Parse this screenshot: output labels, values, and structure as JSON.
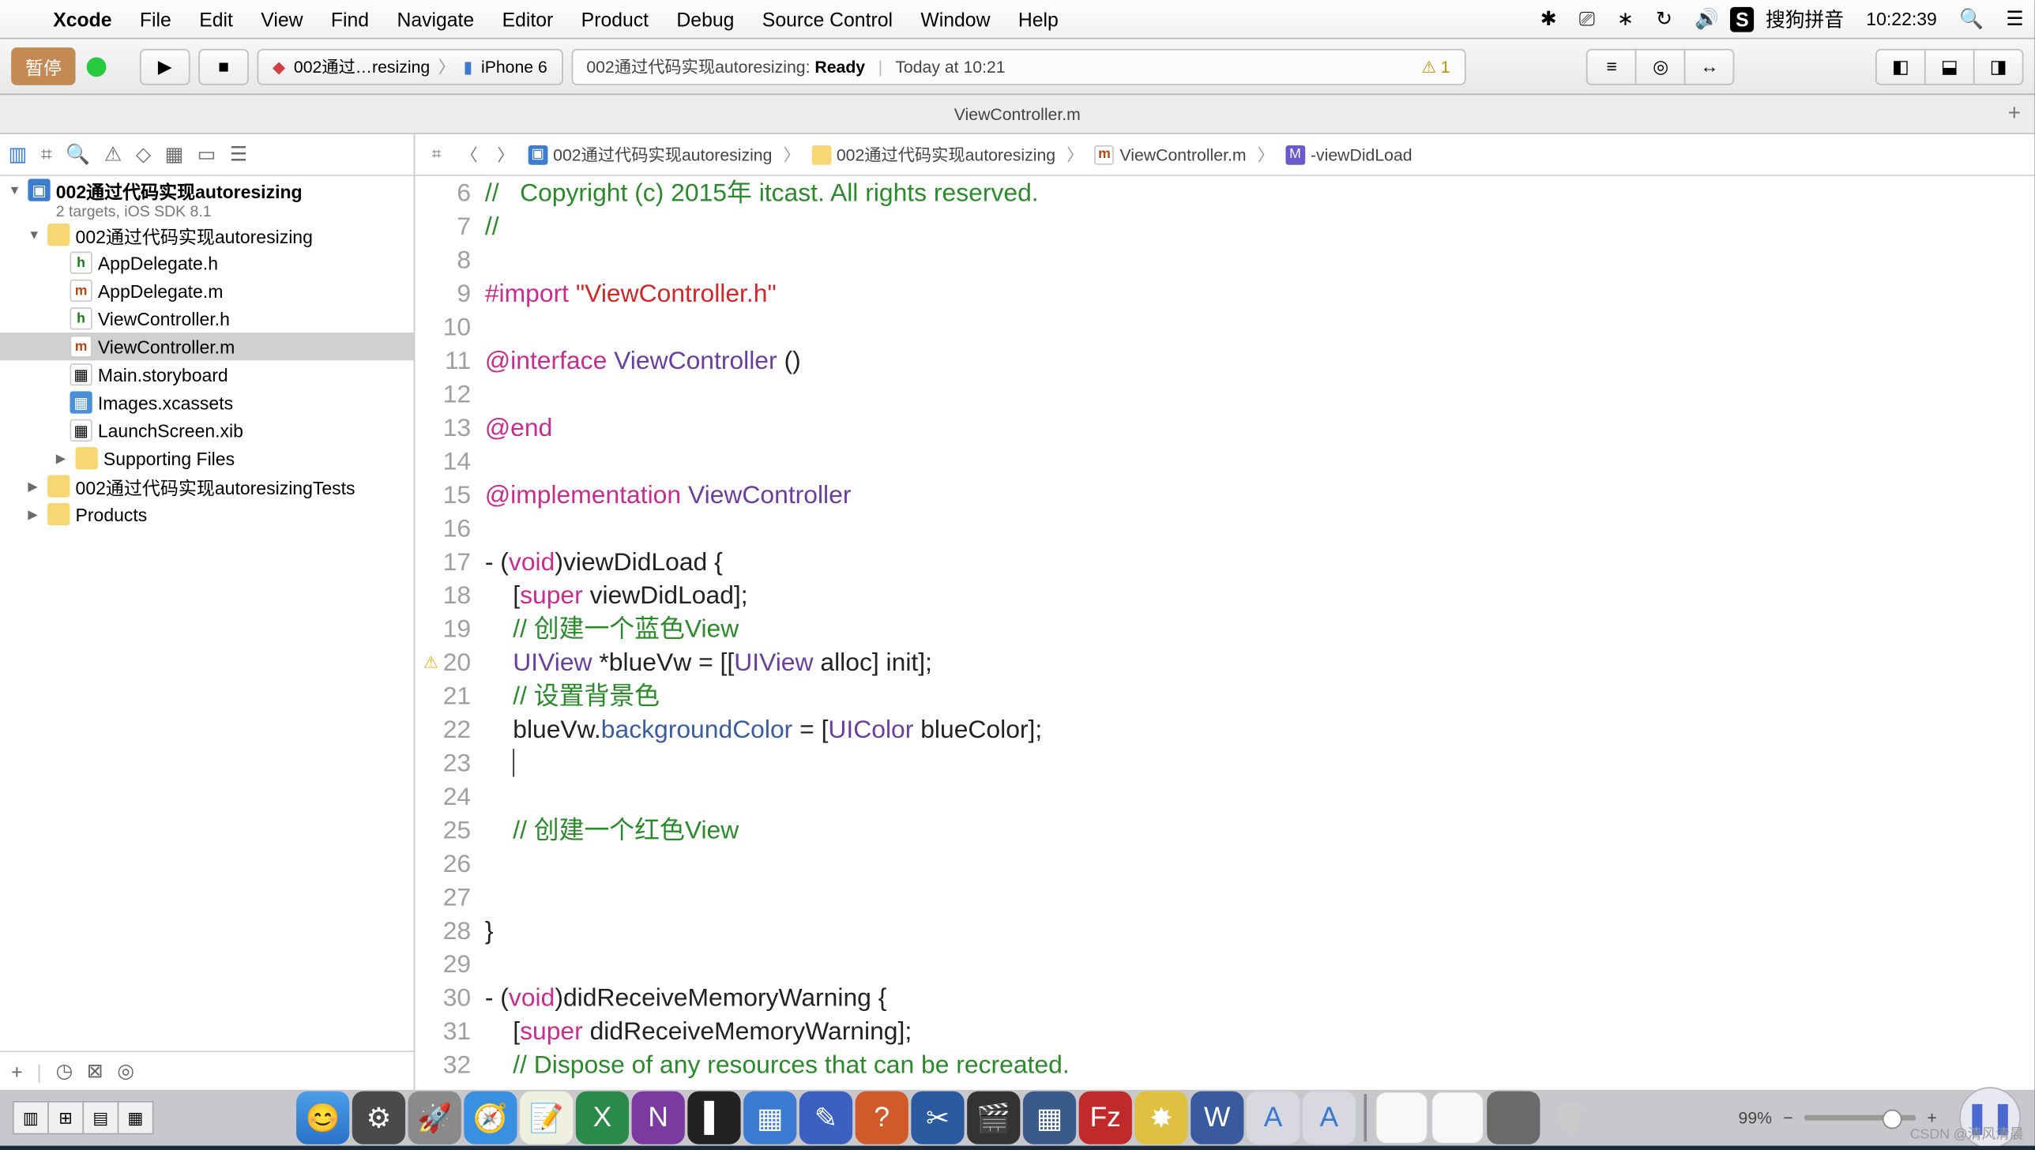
{
  "menubar": {
    "app": "Xcode",
    "items": [
      "File",
      "Edit",
      "View",
      "Find",
      "Navigate",
      "Editor",
      "Product",
      "Debug",
      "Source Control",
      "Window",
      "Help"
    ],
    "ime": "搜狗拼音",
    "clock": "10:22:39"
  },
  "toolbar": {
    "pause": "暂停",
    "scheme_project": "002通过…resizing",
    "scheme_device": "iPhone 6",
    "activity_prefix": "002通过代码实现autoresizing: ",
    "activity_status": "Ready",
    "activity_time": "Today at 10:21",
    "warning_count": "1"
  },
  "tab": {
    "title": "ViewController.m"
  },
  "jumpbar": {
    "c1": "002通过代码实现autoresizing",
    "c2": "002通过代码实现autoresizing",
    "c3": "ViewController.m",
    "c4": "-viewDidLoad"
  },
  "tree": {
    "project": "002通过代码实现autoresizing",
    "project_sub": "2 targets, iOS SDK 8.1",
    "group1": "002通过代码实现autoresizing",
    "files": {
      "f1": "AppDelegate.h",
      "f2": "AppDelegate.m",
      "f3": "ViewController.h",
      "f4": "ViewController.m",
      "f5": "Main.storyboard",
      "f6": "Images.xcassets",
      "f7": "LaunchScreen.xib",
      "f8": "Supporting Files"
    },
    "group2": "002通过代码实现autoresizingTests",
    "group3": "Products"
  },
  "code": {
    "lines": [
      6,
      7,
      8,
      9,
      10,
      11,
      12,
      13,
      14,
      15,
      16,
      17,
      18,
      19,
      20,
      21,
      22,
      23,
      24,
      25,
      26,
      27,
      28,
      29,
      30,
      31,
      32
    ],
    "l6a": "//   Copyright (c) 2015年 itcast. All rights reserved.",
    "l7": "//",
    "l8": "",
    "l9_import": "#import ",
    "l9_str": "\"ViewController.h\"",
    "l10": "",
    "l11_kw": "@interface",
    "l11_cls": " ViewController",
    "l11_rest": " ()",
    "l12": "",
    "l13": "@end",
    "l14": "",
    "l15_kw": "@implementation",
    "l15_cls": " ViewController",
    "l16": "",
    "l17_a": "- (",
    "l17_kw": "void",
    "l17_b": ")viewDidLoad {",
    "l18_a": "    [",
    "l18_kw": "super",
    "l18_b": " viewDidLoad];",
    "l19": "    // 创建一个蓝色View",
    "l20_a": "    ",
    "l20_cls1": "UIView",
    "l20_b": " *blueVw = [[",
    "l20_cls2": "UIView",
    "l20_c": " alloc] init];",
    "l21": "    // 设置背景色",
    "l22_a": "    blueVw.",
    "l22_prop": "backgroundColor",
    "l22_b": " = [",
    "l22_cls": "UIColor",
    "l22_c": " blueColor];",
    "l23": "    ",
    "l24": "",
    "l25": "    // 创建一个红色View",
    "l26": "",
    "l27": "",
    "l28": "}",
    "l29": "",
    "l30_a": "- (",
    "l30_kw": "void",
    "l30_b": ")didReceiveMemoryWarning {",
    "l31_a": "    [",
    "l31_kw": "super",
    "l31_b": " didReceiveMemoryWarning];",
    "l32": "    // Dispose of any resources that can be recreated."
  },
  "dock": {
    "zoom": "99%"
  },
  "watermark": "CSDN @清风清晨"
}
